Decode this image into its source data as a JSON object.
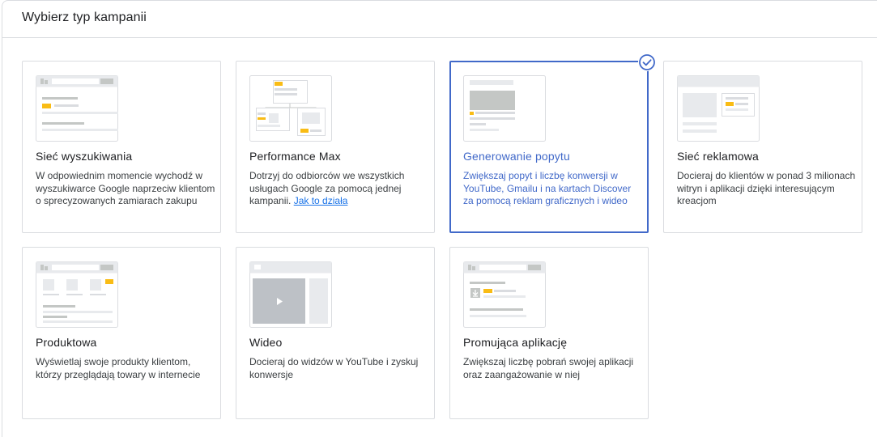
{
  "header": {
    "title": "Wybierz typ kampanii"
  },
  "campaigns": [
    {
      "title": "Sieć wyszukiwania",
      "desc": "W odpowiednim momencie wychodź w wyszukiwarce Google naprzeciw klientom o sprecyzowanych zamiarach zakupu",
      "selected": false
    },
    {
      "title": "Performance Max",
      "desc": "Dotrzyj do odbiorców we wszystkich usługach Google za pomocą jednej kampanii.",
      "link": "Jak to działa",
      "selected": false
    },
    {
      "title": "Generowanie popytu",
      "desc": "Zwiększaj popyt i liczbę konwersji w YouTube, Gmailu i na kartach Discover za pomocą reklam graficznych i wideo",
      "selected": true
    },
    {
      "title": "Sieć reklamowa",
      "desc": "Docieraj do klientów w ponad 3 milionach witryn i aplikacji dzięki interesującym kreacjom",
      "selected": false
    },
    {
      "title": "Produktowa",
      "desc": "Wyświetlaj swoje produkty klientom, którzy przeglądają towary w internecie",
      "selected": false
    },
    {
      "title": "Wideo",
      "desc": "Docieraj do widzów w YouTube i zyskuj konwersje",
      "selected": false
    },
    {
      "title": "Promująca aplikację",
      "desc": "Zwiększaj liczbę pobrań swojej aplikacji oraz zaangażowanie w niej",
      "selected": false
    }
  ],
  "colors": {
    "accent": "#4169c9",
    "highlight": "#f9bc15",
    "link": "#1a73e8"
  }
}
